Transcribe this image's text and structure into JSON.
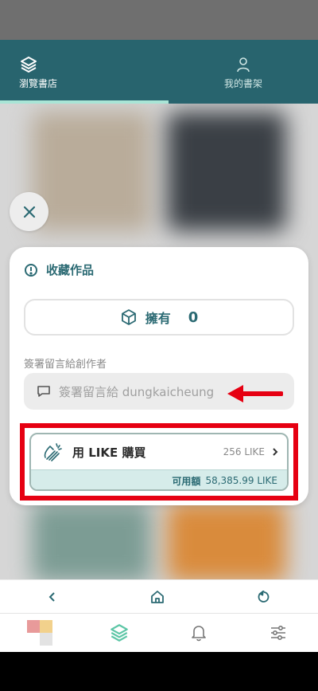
{
  "top_tabs": [
    {
      "label": "瀏覽書店",
      "icon": "layers-icon",
      "active": true
    },
    {
      "label": "我的書架",
      "icon": "user-icon",
      "active": false
    }
  ],
  "dialog": {
    "title": "收藏作品",
    "own": {
      "label": "擁有",
      "count": "0"
    },
    "message": {
      "title": "簽署留言給創作者",
      "placeholder": "簽署留言給 dungkaicheung"
    },
    "purchase": {
      "label": "用 LIKE 購買",
      "price": "256 LIKE",
      "balance_label": "可用額",
      "balance_value": "58,385.99 LIKE"
    }
  },
  "browser_controls": [
    "back-icon",
    "home-icon",
    "reload-icon"
  ],
  "bottom_nav": [
    "app-logo",
    "layers-icon",
    "bell-icon",
    "settings-sliders-icon"
  ],
  "colors": {
    "primary": "#28646e",
    "accent_underline": "#a9e5d6",
    "highlight_red": "#e60012",
    "balance_bg": "#d6ecea"
  }
}
